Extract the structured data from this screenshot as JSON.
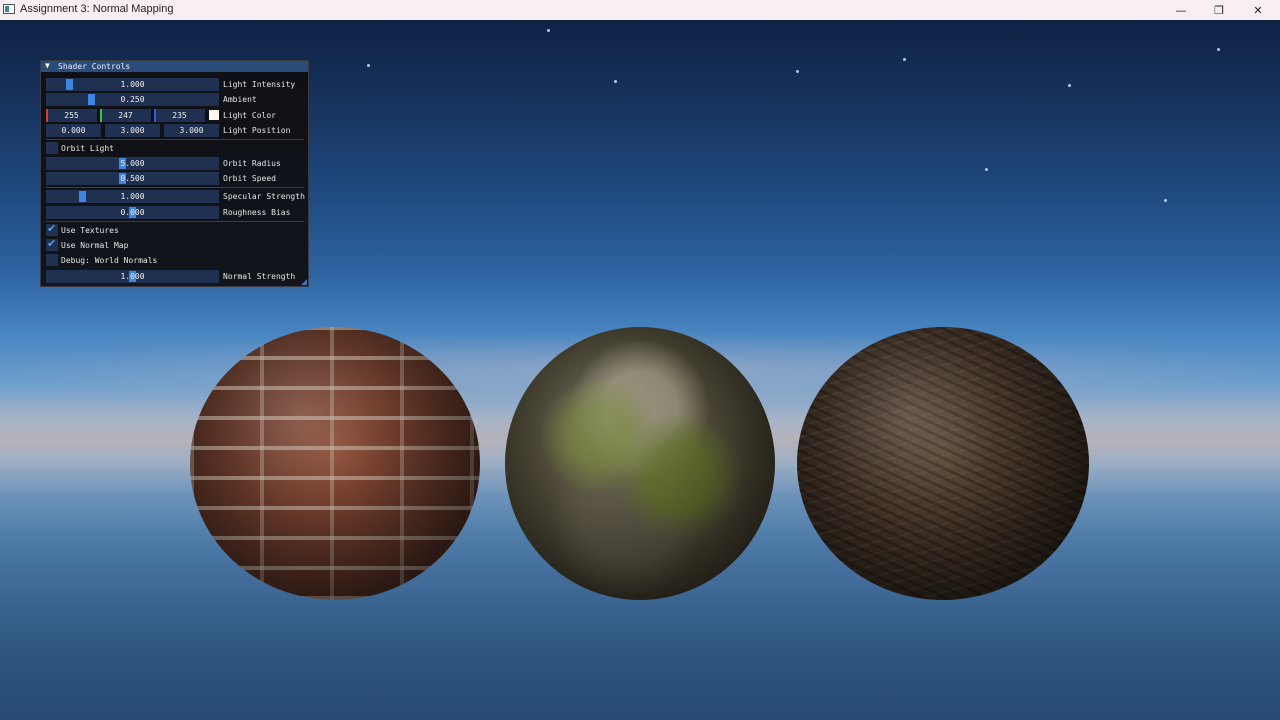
{
  "window": {
    "title": "Assignment 3: Normal Mapping",
    "minimize_icon": "—",
    "restore_icon": "❐",
    "close_icon": "✕"
  },
  "panel": {
    "title": "Shader Controls",
    "collapse_icon": "▼",
    "light_intensity": {
      "label": "Light Intensity",
      "value": "1.000",
      "fraction": 0.12
    },
    "ambient": {
      "label": "Ambient",
      "value": "0.250",
      "fraction": 0.25
    },
    "light_color": {
      "label": "Light Color",
      "r": "255",
      "g": "247",
      "b": "235",
      "swatch": "#fff7eb"
    },
    "light_position": {
      "label": "Light Position",
      "x": "0.000",
      "y": "3.000",
      "z": "3.000"
    },
    "orbit_light": {
      "label": "Orbit Light",
      "checked": false
    },
    "orbit_radius": {
      "label": "Orbit Radius",
      "value": "5.000",
      "fraction": 0.44
    },
    "orbit_speed": {
      "label": "Orbit Speed",
      "value": "0.500",
      "fraction": 0.44
    },
    "specular_strength": {
      "label": "Specular Strength",
      "value": "1.000",
      "fraction": 0.2
    },
    "roughness_bias": {
      "label": "Roughness Bias",
      "value": "0.000",
      "fraction": 0.5
    },
    "use_textures": {
      "label": "Use Textures",
      "checked": true
    },
    "use_normal_map": {
      "label": "Use Normal Map",
      "checked": true
    },
    "debug_world_normals": {
      "label": "Debug: World Normals",
      "checked": false
    },
    "normal_strength": {
      "label": "Normal Strength",
      "value": "1.000",
      "fraction": 0.5
    }
  },
  "spheres": [
    "brick",
    "mossy-rock",
    "bark"
  ],
  "colors": {
    "accent": "#3d85e0",
    "panel_bg": "#0f0f12",
    "field_bg": "#1f3050",
    "header": "#2b4b78"
  }
}
